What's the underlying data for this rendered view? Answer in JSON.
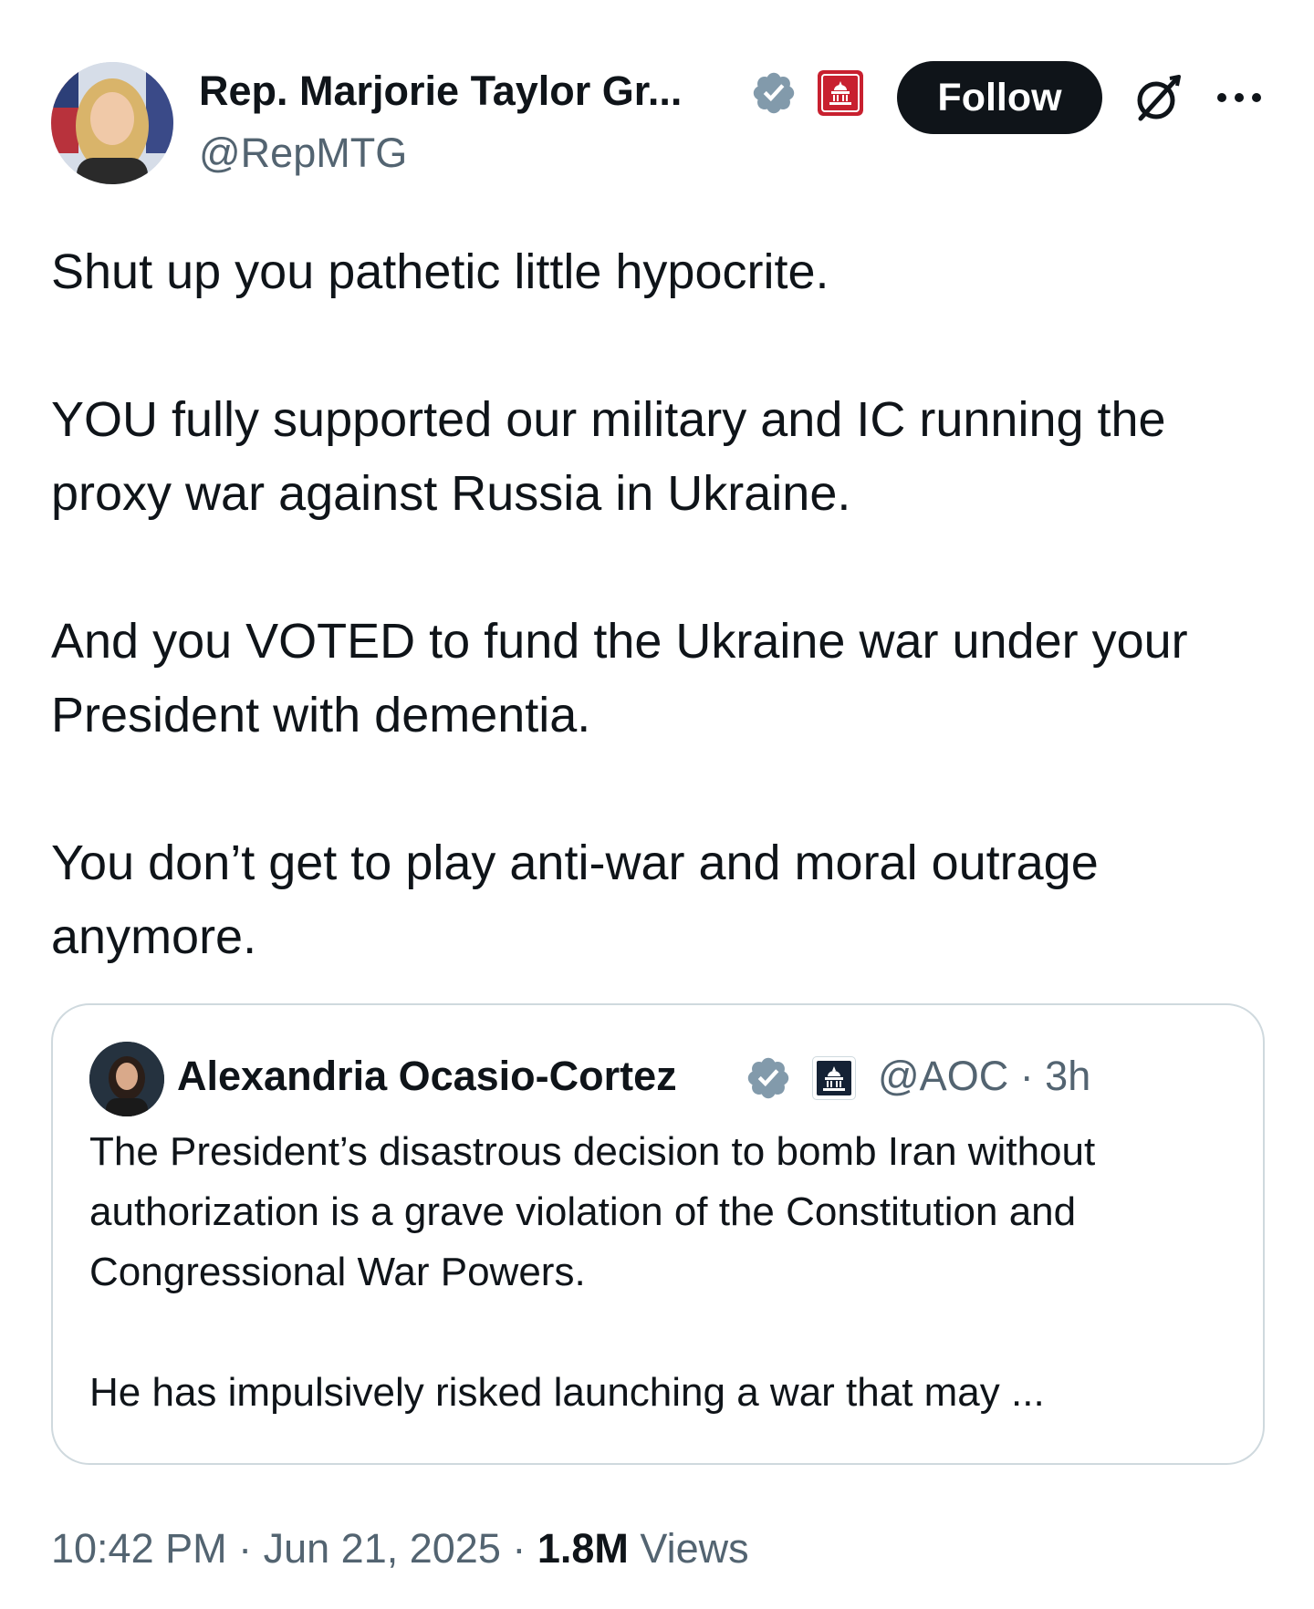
{
  "author": {
    "name": "Rep. Marjorie Taylor Gr...",
    "handle": "@RepMTG"
  },
  "header": {
    "follow_label": "Follow"
  },
  "icons": {
    "verified": "verified-badge-icon",
    "affiliation": "house-gop-capitol-icon",
    "grok": "grok-icon",
    "more": "more-icon"
  },
  "colors": {
    "text": "#0f1419",
    "secondary_text": "#536471",
    "verified_blue": "#829aab",
    "border": "#cfd9de",
    "follow_bg": "#0f1419",
    "gop_red": "#c8202f",
    "dem_navy": "#152235"
  },
  "tweet": {
    "paragraphs": [
      "Shut up you pathetic little hypocrite.",
      "YOU fully supported our military and IC running the proxy war against Russia in Ukraine.",
      "And you VOTED to fund the Ukraine war under your President with dementia.",
      "You don’t get to play anti-war and moral outrage anymore."
    ]
  },
  "quote": {
    "name": "Alexandria Ocasio-Cortez",
    "handle_time": "@AOC · 3h",
    "paragraphs": [
      "The President’s disastrous decision to bomb Iran without authorization is a grave violation of the Constitution and Congressional War Powers.",
      "He has impulsively risked launching a war that may ..."
    ]
  },
  "meta": {
    "time": "10:42 PM",
    "date": "Jun 21, 2025",
    "separator": " · ",
    "views_count": "1.8M",
    "views_label": "Views"
  }
}
